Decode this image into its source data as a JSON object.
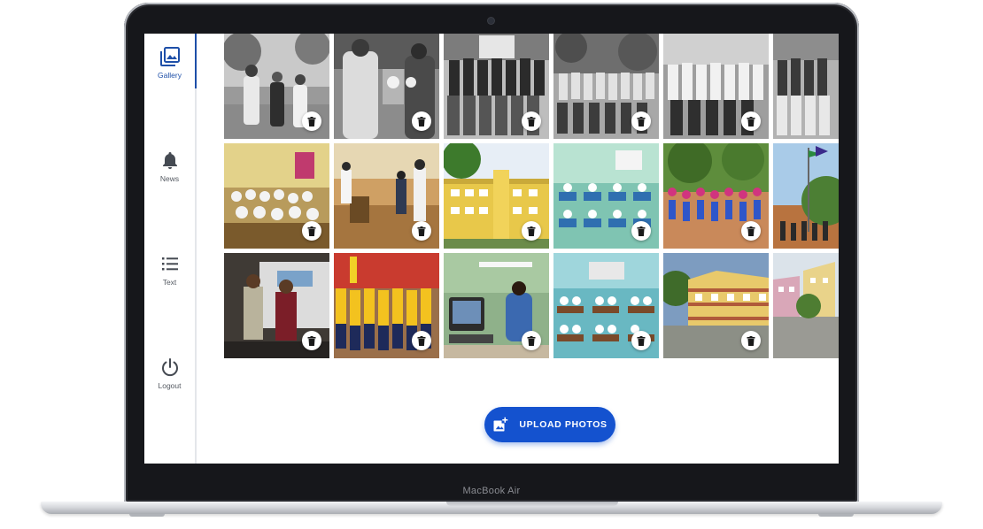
{
  "device": {
    "model_label": "MacBook Air"
  },
  "sidebar": {
    "items": [
      {
        "label": "Gallery",
        "icon": "gallery-icon",
        "active": true
      },
      {
        "label": "News",
        "icon": "bell-icon",
        "active": false
      },
      {
        "label": "Text",
        "icon": "list-icon",
        "active": false
      },
      {
        "label": "Logout",
        "icon": "power-icon",
        "active": false
      }
    ]
  },
  "gallery": {
    "photos": [
      {
        "subject": "vintage ceremony handshake (black and white)",
        "delete_icon": "trash-icon"
      },
      {
        "subject": "vintage award presentation (black and white)",
        "delete_icon": "trash-icon"
      },
      {
        "subject": "vintage staff group photo (black and white)",
        "delete_icon": "trash-icon"
      },
      {
        "subject": "vintage class group photo outdoors (black and white)",
        "delete_icon": "trash-icon"
      },
      {
        "subject": "vintage group photo seated (black and white)",
        "delete_icon": "trash-icon"
      },
      {
        "subject": "vintage group photo standing (black and white)",
        "delete_icon": "trash-icon"
      },
      {
        "subject": "classroom with students",
        "delete_icon": "trash-icon"
      },
      {
        "subject": "science lab with students",
        "delete_icon": "trash-icon"
      },
      {
        "subject": "yellow school building",
        "delete_icon": "trash-icon"
      },
      {
        "subject": "students in classroom",
        "delete_icon": "trash-icon"
      },
      {
        "subject": "sports day drill in ground",
        "delete_icon": "trash-icon"
      },
      {
        "subject": "flag hoisting ceremony",
        "delete_icon": "trash-icon"
      },
      {
        "subject": "speaker on stage",
        "delete_icon": "trash-icon"
      },
      {
        "subject": "march past parade",
        "delete_icon": "trash-icon"
      },
      {
        "subject": "computer lab",
        "delete_icon": "trash-icon"
      },
      {
        "subject": "classroom with students",
        "delete_icon": "trash-icon"
      },
      {
        "subject": "school building wide view",
        "delete_icon": "trash-icon"
      },
      {
        "subject": "school courtyard",
        "delete_icon": "trash-icon"
      }
    ]
  },
  "upload": {
    "label": "UPLOAD PHOTOS",
    "icon": "add-photo-icon"
  },
  "colors": {
    "accent": "#1452cf",
    "nav_active": "#1e4fa8",
    "bezel": "#16171b"
  }
}
